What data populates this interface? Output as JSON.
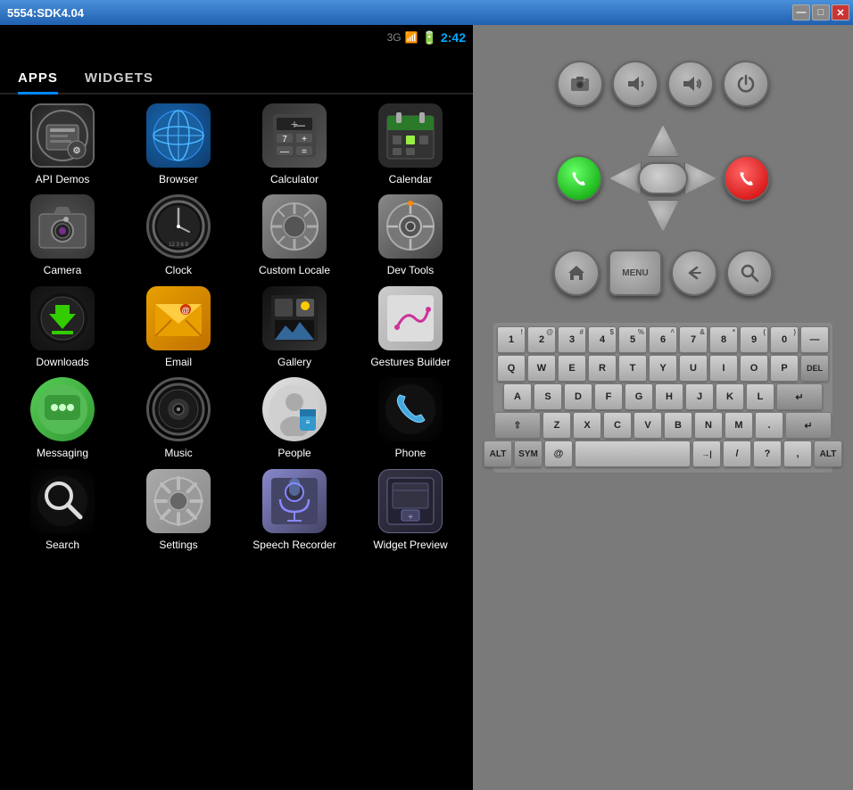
{
  "window": {
    "title": "5554:SDK4.04",
    "minimize": "—",
    "maximize": "□",
    "close": "✕"
  },
  "statusbar": {
    "network": "3G",
    "time": "2:42"
  },
  "tabs": [
    {
      "id": "apps",
      "label": "APPS",
      "active": true
    },
    {
      "id": "widgets",
      "label": "WIDGETS",
      "active": false
    }
  ],
  "apps": [
    {
      "id": "api-demos",
      "label": "API Demos",
      "icon": "api"
    },
    {
      "id": "browser",
      "label": "Browser",
      "icon": "browser"
    },
    {
      "id": "calculator",
      "label": "Calculator",
      "icon": "calculator"
    },
    {
      "id": "calendar",
      "label": "Calendar",
      "icon": "calendar"
    },
    {
      "id": "camera",
      "label": "Camera",
      "icon": "camera"
    },
    {
      "id": "clock",
      "label": "Clock",
      "icon": "clock"
    },
    {
      "id": "custom-locale",
      "label": "Custom Locale",
      "icon": "custom"
    },
    {
      "id": "dev-tools",
      "label": "Dev Tools",
      "icon": "devtools"
    },
    {
      "id": "downloads",
      "label": "Downloads",
      "icon": "downloads"
    },
    {
      "id": "email",
      "label": "Email",
      "icon": "email"
    },
    {
      "id": "gallery",
      "label": "Gallery",
      "icon": "gallery"
    },
    {
      "id": "gestures-builder",
      "label": "Gestures Builder",
      "icon": "gestures"
    },
    {
      "id": "messaging",
      "label": "Messaging",
      "icon": "messaging"
    },
    {
      "id": "music",
      "label": "Music",
      "icon": "music"
    },
    {
      "id": "people",
      "label": "People",
      "icon": "people"
    },
    {
      "id": "phone",
      "label": "Phone",
      "icon": "phone"
    },
    {
      "id": "search",
      "label": "Search",
      "icon": "search"
    },
    {
      "id": "settings",
      "label": "Settings",
      "icon": "settings"
    },
    {
      "id": "speech-recorder",
      "label": "Speech Recorder",
      "icon": "speech"
    },
    {
      "id": "widget-preview",
      "label": "Widget Preview",
      "icon": "widget"
    }
  ],
  "controls": {
    "camera_btn": "📷",
    "volume_down": "🔉",
    "volume_up": "🔊",
    "power": "⏻",
    "call": "📞",
    "end_call": "📵",
    "home": "⌂",
    "menu": "MENU",
    "back": "↩",
    "search": "🔍"
  },
  "keyboard": {
    "rows": [
      [
        "! 1",
        "@ 2",
        "# 3",
        "$ 4",
        "% 5",
        "^ 6",
        "& 7",
        "* 8",
        "( 9",
        ") 0",
        "— —"
      ],
      [
        "Q",
        "W",
        "E",
        "R",
        "T",
        "Y",
        "U",
        "I",
        "O",
        "P",
        "DEL"
      ],
      [
        "A",
        "S",
        "D",
        "F",
        "G",
        "H",
        "J",
        "K",
        "L",
        "↵"
      ],
      [
        "⇧",
        "Z",
        "X",
        "C",
        "V",
        "B",
        "N",
        "M",
        ".",
        "↵"
      ],
      [
        "ALT",
        "SYM",
        "@",
        "SPACE",
        "→|",
        "/",
        "?",
        ",",
        "ALT"
      ]
    ]
  }
}
